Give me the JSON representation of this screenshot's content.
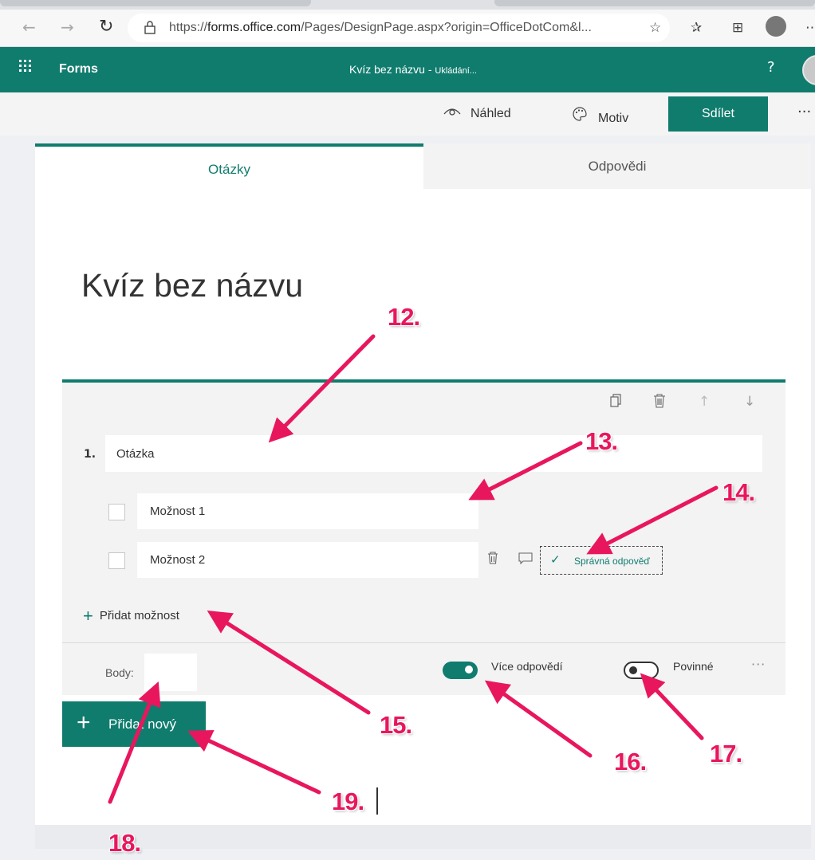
{
  "browser": {
    "back_icon": "arrow-left-icon",
    "forward_icon": "arrow-right-icon",
    "reload_icon": "reload-icon",
    "lock_icon": "lock-icon",
    "url_prefix": "https://",
    "url_host": "forms.office.com",
    "url_path": "/Pages/DesignPage.aspx?origin=OfficeDotCom&l...",
    "favorite_icon": "star-add-icon",
    "favorites_icon": "favorites-list-icon",
    "collections_icon": "collections-icon",
    "profile_icon": "profile-icon",
    "more_icon": "more-icon"
  },
  "app": {
    "name": "Forms",
    "doc_title": "Kvíz bez názvu - ",
    "doc_status": "Ukládání...",
    "help": "?",
    "brand_color": "#107c6e"
  },
  "commands": {
    "preview_label": "Náhled",
    "theme_label": "Motiv",
    "share_label": "Sdílet",
    "more": "···"
  },
  "tabs": [
    {
      "label": "Otázky",
      "selected": true
    },
    {
      "label": "Odpovědi",
      "selected": false
    }
  ],
  "quiz": {
    "title": "Kvíz bez názvu",
    "question": {
      "number": "1.",
      "text": "Otázka",
      "options": [
        "Možnost 1",
        "Možnost 2"
      ],
      "correct_answer_label": "Správná odpověď",
      "add_option_label": "Přidat možnost",
      "points_label": "Body:",
      "multiple_answers_label": "Více odpovědí",
      "multiple_answers_on": true,
      "required_label": "Povinné",
      "required_on": false,
      "more": "···"
    },
    "add_new_label": "Přidat nový"
  },
  "annotations": [
    "12.",
    "13.",
    "14.",
    "15.",
    "16.",
    "17.",
    "18.",
    "19."
  ],
  "annotation_color": "#e8175d"
}
